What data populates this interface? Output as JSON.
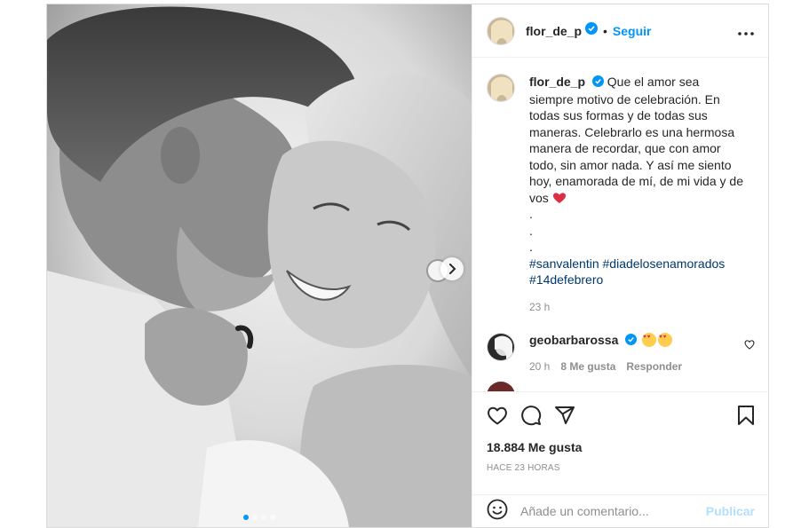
{
  "header": {
    "username": "flor_de_p",
    "separator": "•",
    "follow_label": "Seguir",
    "more_icon": "more-horizontal-icon"
  },
  "caption": {
    "username": "flor_de_p",
    "text": "Que el amor sea siempre motivo de celebración. En todas sus formas y de todas sus maneras. Celebrarlo es una hermosa manera de recordar, que con amor todo, sin amor nada. Y así me siento hoy, enamorada de mí, de mi vida y de vos",
    "dots": [
      ".",
      ".",
      "."
    ],
    "hashtags": [
      "#sanvalentin",
      "#diadelosenamorados",
      "#14defebrero"
    ],
    "time": "23 h"
  },
  "comments": [
    {
      "username": "geobarbarossa",
      "time": "20 h",
      "likes": "8 Me gusta",
      "reply_label": "Responder"
    }
  ],
  "actions": {
    "likes_count": "18.884 Me gusta",
    "posted_ago": "HACE 23 HORAS"
  },
  "add_comment": {
    "placeholder": "Añade un comentario...",
    "publish_label": "Publicar"
  },
  "carousel": {
    "total_slides": 4,
    "current_slide": 1
  },
  "colors": {
    "accent": "#0095f6",
    "hashtag": "#00376b",
    "muted": "#8e8e8e",
    "heart_red": "#ed4956"
  }
}
